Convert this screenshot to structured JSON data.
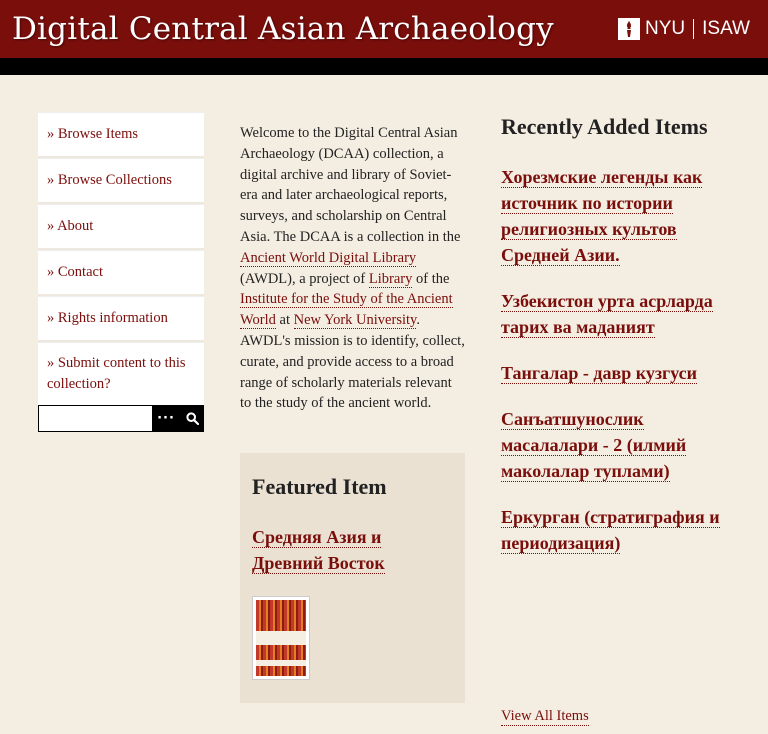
{
  "header": {
    "title": "Digital Central Asian Archaeology",
    "logo_nyu": "NYU",
    "logo_isaw": "ISAW"
  },
  "nav": {
    "items": [
      {
        "label": "» Browse Items"
      },
      {
        "label": "» Browse Collections"
      },
      {
        "label": "» About"
      },
      {
        "label": "» Contact"
      },
      {
        "label": "» Rights information"
      },
      {
        "label": "» Submit content to this collection?"
      }
    ]
  },
  "search": {
    "value": "",
    "advanced_label": "···",
    "submit_icon": "search-icon"
  },
  "intro": {
    "t1": "Welcome to the Digital Central Asian Archaeology (DCAA) collection, a digital archive and library of Soviet-era and later archaeological reports, surveys, and scholarship on Central Asia. The DCAA is a collection in the ",
    "l1": "Ancient World Digital Library",
    "t2": " (AWDL), a project of ",
    "l2": "Library",
    "t3": " of the ",
    "l3": "Institute for the Study of the Ancient World",
    "t4": " at ",
    "l4": "New York University",
    "t5": ". AWDL's mission is to identify, collect, curate, and provide access to a broad range of scholarly materials relevant to the study of the ancient world."
  },
  "featured": {
    "heading": "Featured Item",
    "title": "Средняя Азия и Древний Восток"
  },
  "recent": {
    "heading": "Recently Added Items",
    "items": [
      {
        "title": "Хорезмские легенды как источник по истории религиозных культов Средней Азии."
      },
      {
        "title": "Узбекистон урта асрларда тарих ва маданият"
      },
      {
        "title": "Тангалар - давр кузгуси"
      },
      {
        "title": "Санъатшунослик масалалари - 2 (илмий маколалар туплами)"
      },
      {
        "title": "Еркурган (стратиграфия и периодизация)"
      }
    ],
    "view_all": "View All Items"
  },
  "colors": {
    "brand": "#7a0e0b",
    "background": "#f4ede2",
    "featured_bg": "#ebe1d3"
  }
}
